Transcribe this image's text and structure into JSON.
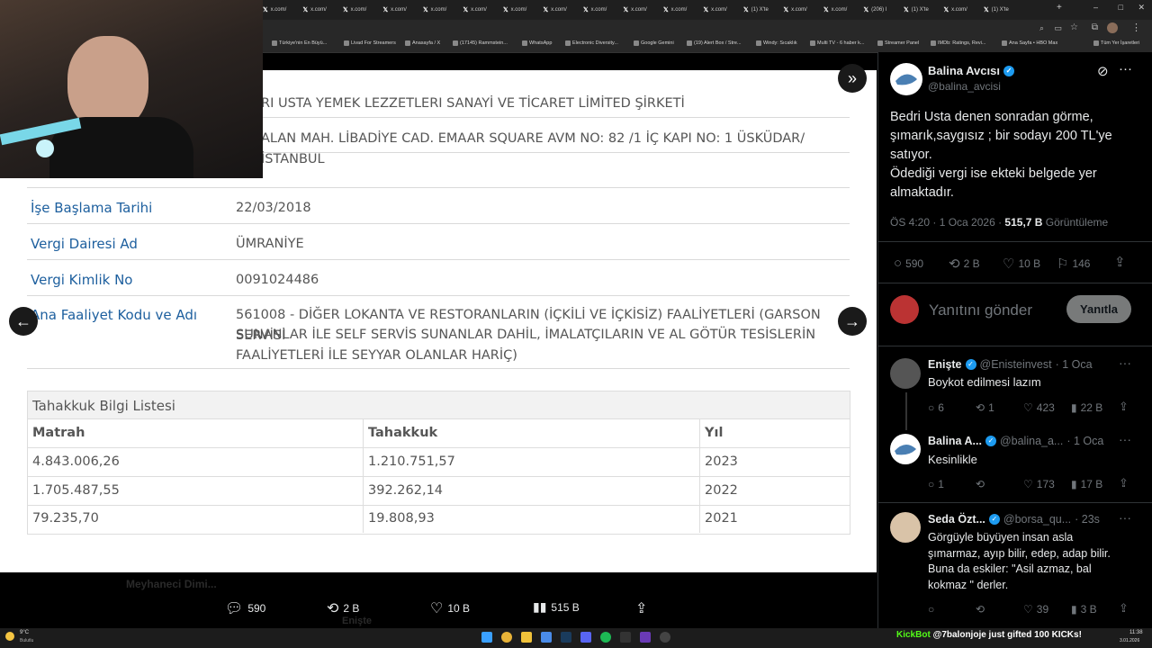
{
  "browser": {
    "tabs": [
      "x.com/",
      "x.com/",
      "x.com/",
      "x.com/",
      "x.com/",
      "x.com/",
      "x.com/",
      "x.com/",
      "x.com/",
      "x.com/",
      "x.com/",
      "x.com/",
      "(1) X'te",
      "x.com/",
      "x.com/",
      "(206) I",
      "(1) X'te",
      "x.com/",
      "(1) X'te"
    ],
    "bookmarks": [
      "Türkiye'nin En Büyü...",
      "Livad For Streamers",
      "Anasayfa / X",
      "(17145) Rammstein...",
      "WhatsApp",
      "Electronic Diversity...",
      "Google Gemini",
      "(19) Alert Box / Stre...",
      "Windy: Sıcaklık",
      "Multi TV - 6 haber k...",
      "Streamer Panel",
      "IMDb: Ratings, Revi...",
      "Ana Sayfa • HBO Max",
      "Tüm Yer İşaretleri"
    ]
  },
  "document": {
    "company_line": "RI USTA YEMEK LEZZETLERI SANAYİ VE TİCARET LİMİTED ŞİRKETİ",
    "address_line": "ALAN MAH. LİBADİYE CAD. EMAAR SQUARE AVM NO: 82 /1 İÇ KAPI NO: 1 ÜSKÜDAR/ İSTANBUL",
    "fields": [
      {
        "label": "İşe Başlama Tarihi",
        "value": "22/03/2018"
      },
      {
        "label": "Vergi Dairesi Ad",
        "value": "ÜMRANİYE"
      },
      {
        "label": "Vergi Kimlik No",
        "value": "0091024486"
      },
      {
        "label": "Ana Faaliyet Kodu ve Adı",
        "value_lines": [
          "561008 - DİĞER LOKANTA VE RESTORANLARIN (İÇKİLİ VE İÇKİSİZ) FAALİYETLERİ (GARSON SERVİSİ",
          "SUNANLAR İLE SELF SERVİS SUNANLAR DAHİL, İMALATÇILARIN VE AL GÖTÜR TESİSLERİN",
          "FAALİYETLERİ İLE SEYYAR OLANLAR HARİÇ)"
        ]
      }
    ],
    "table_title": "Tahakkuk Bilgi Listesi",
    "table_headers": [
      "Matrah",
      "Tahakkuk",
      "Yıl"
    ],
    "table_rows": [
      [
        "4.843.006,26",
        "1.210.751,57",
        "2023"
      ],
      [
        "1.705.487,55",
        "392.262,14",
        "2022"
      ],
      [
        "79.235,70",
        "19.808,93",
        "2021"
      ]
    ]
  },
  "media_actions": {
    "replies": "590",
    "reposts": "2 B",
    "likes": "10 B",
    "views": "515 B"
  },
  "tweet": {
    "author_name": "Balina Avcısı",
    "author_handle": "@balina_avcisi",
    "text_lines": [
      "Bedri Usta denen sonradan görme,",
      "şımarık,saygısız ; bir sodayı 200 TL'ye",
      "satıyor.",
      "Ödediği vergi ise ekteki belgede yer",
      "almaktadır."
    ],
    "time": "ÖS 4:20 · 1 Oca 2026 ·",
    "views": "515,7 B",
    "views_label": "Görüntüleme",
    "stats": {
      "replies": "590",
      "reposts": "2 B",
      "likes": "10 B",
      "bookmarks": "146"
    },
    "reply_placeholder": "Yanıtını gönder",
    "reply_button": "Yanıtla"
  },
  "replies": [
    {
      "name": "Enişte",
      "handle": "@Enisteinvest",
      "time": "· 1 Oca",
      "text": "Boykot edilmesi lazım",
      "replies": "6",
      "reposts": "1",
      "likes": "423",
      "views": "22 B"
    },
    {
      "name": "Balina A...",
      "handle": "@balina_a...",
      "time": "· 1 Oca",
      "text": "Kesinlikle",
      "replies": "1",
      "reposts": "",
      "likes": "173",
      "views": "17 B"
    },
    {
      "name": "Seda Özt...",
      "handle": "@borsa_qu...",
      "time": "· 23s",
      "text_lines": [
        "Görgüyle büyüyen insan asla",
        "şımarmaz, ayıp bilir, edep, adap bilir.",
        "Buna da eskiler: \"Asil azmaz, bal",
        "kokmaz \" derler."
      ],
      "replies": "",
      "reposts": "",
      "likes": "39",
      "views": "3 B"
    }
  ],
  "overlay_text": {
    "bg_name": "Meyhaneci Dimi...",
    "bg_name2": "Enişte"
  },
  "kick_alert": {
    "brand": "KickBot",
    "message": "@7balonjoje just gifted 100 KICKs!"
  },
  "taskbar": {
    "weather_temp": "9°C",
    "weather_desc": "Bulutlu",
    "time": "11:38",
    "date": "3.01.2026"
  },
  "colors": {
    "x_blue": "#1d9bf0",
    "doc_label": "#1d5f9e",
    "kick_green": "#53fc18"
  }
}
